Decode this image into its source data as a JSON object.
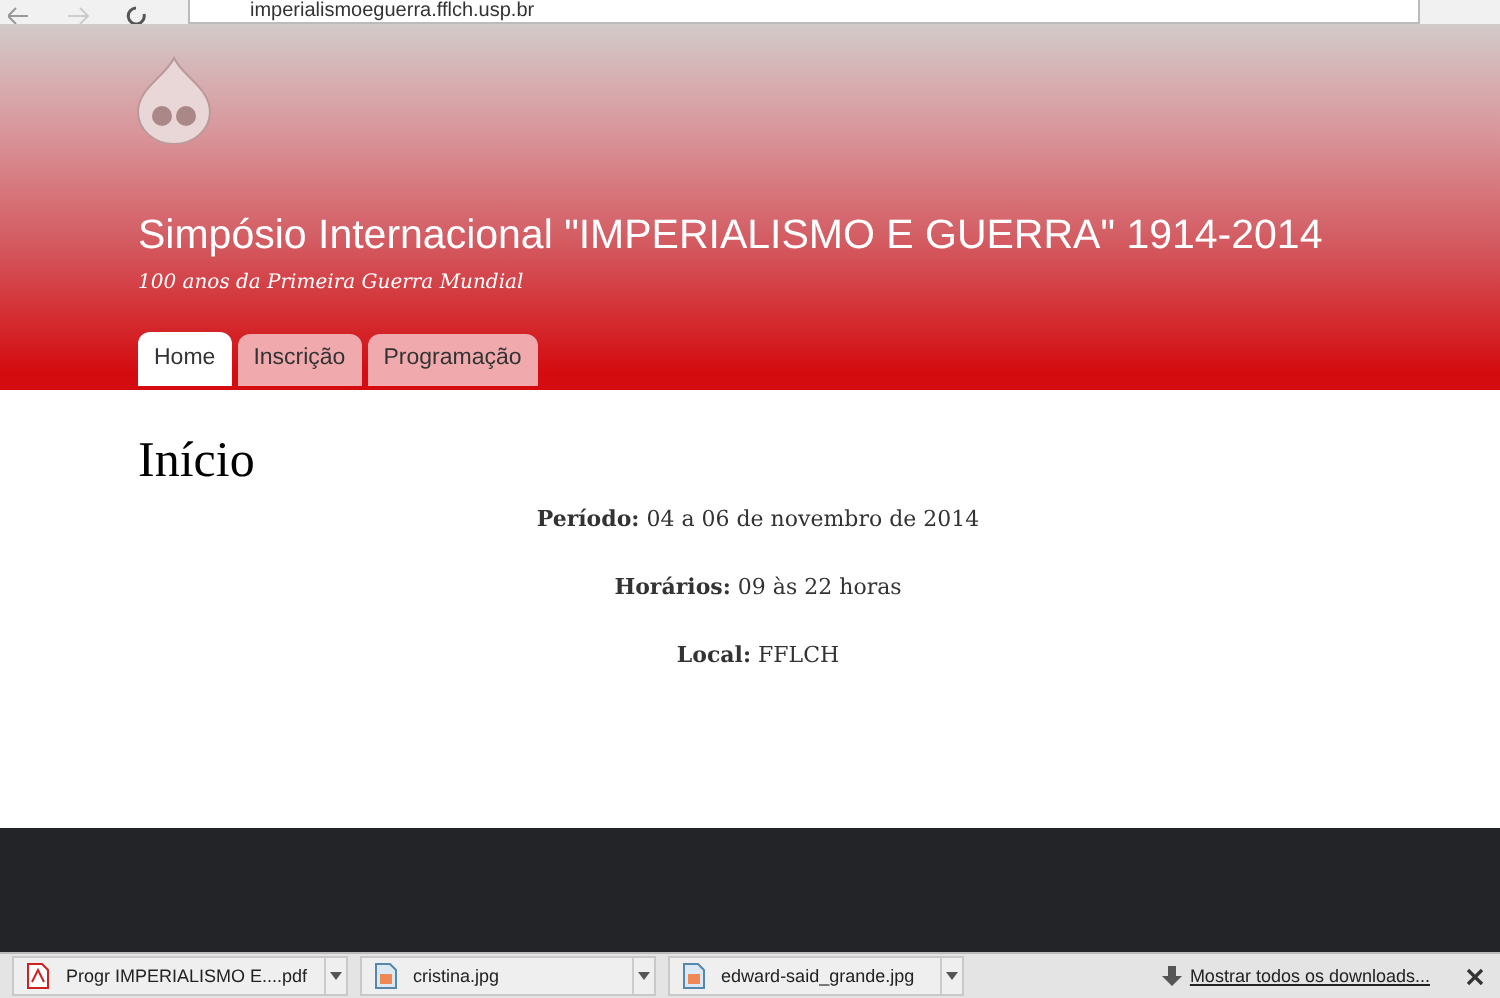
{
  "browser": {
    "url": "imperialismoeguerra.fflch.usp.br"
  },
  "site": {
    "title": "Simpósio Internacional \"IMPERIALISMO E GUERRA\" 1914-2014",
    "slogan": "100 anos da Primeira Guerra Mundial"
  },
  "tabs": [
    {
      "label": "Home",
      "selected": true
    },
    {
      "label": "Inscrição",
      "selected": false
    },
    {
      "label": "Programação",
      "selected": false
    }
  ],
  "page": {
    "heading": "Início",
    "lines": [
      "**Período:** 04 a 06 de novembro de 2014",
      "**Horários:** 09 às 22 horas",
      "**Local:** FFLCH"
    ]
  },
  "downloads": {
    "items": [
      {
        "name": "Progr IMPERIALISMO E....pdf",
        "kind": "pdf"
      },
      {
        "name": "cristina.jpg",
        "kind": "image"
      },
      {
        "name": "edward-said_grande.jpg",
        "kind": "image"
      }
    ],
    "show_all": "Mostrar todos os downloads..."
  }
}
